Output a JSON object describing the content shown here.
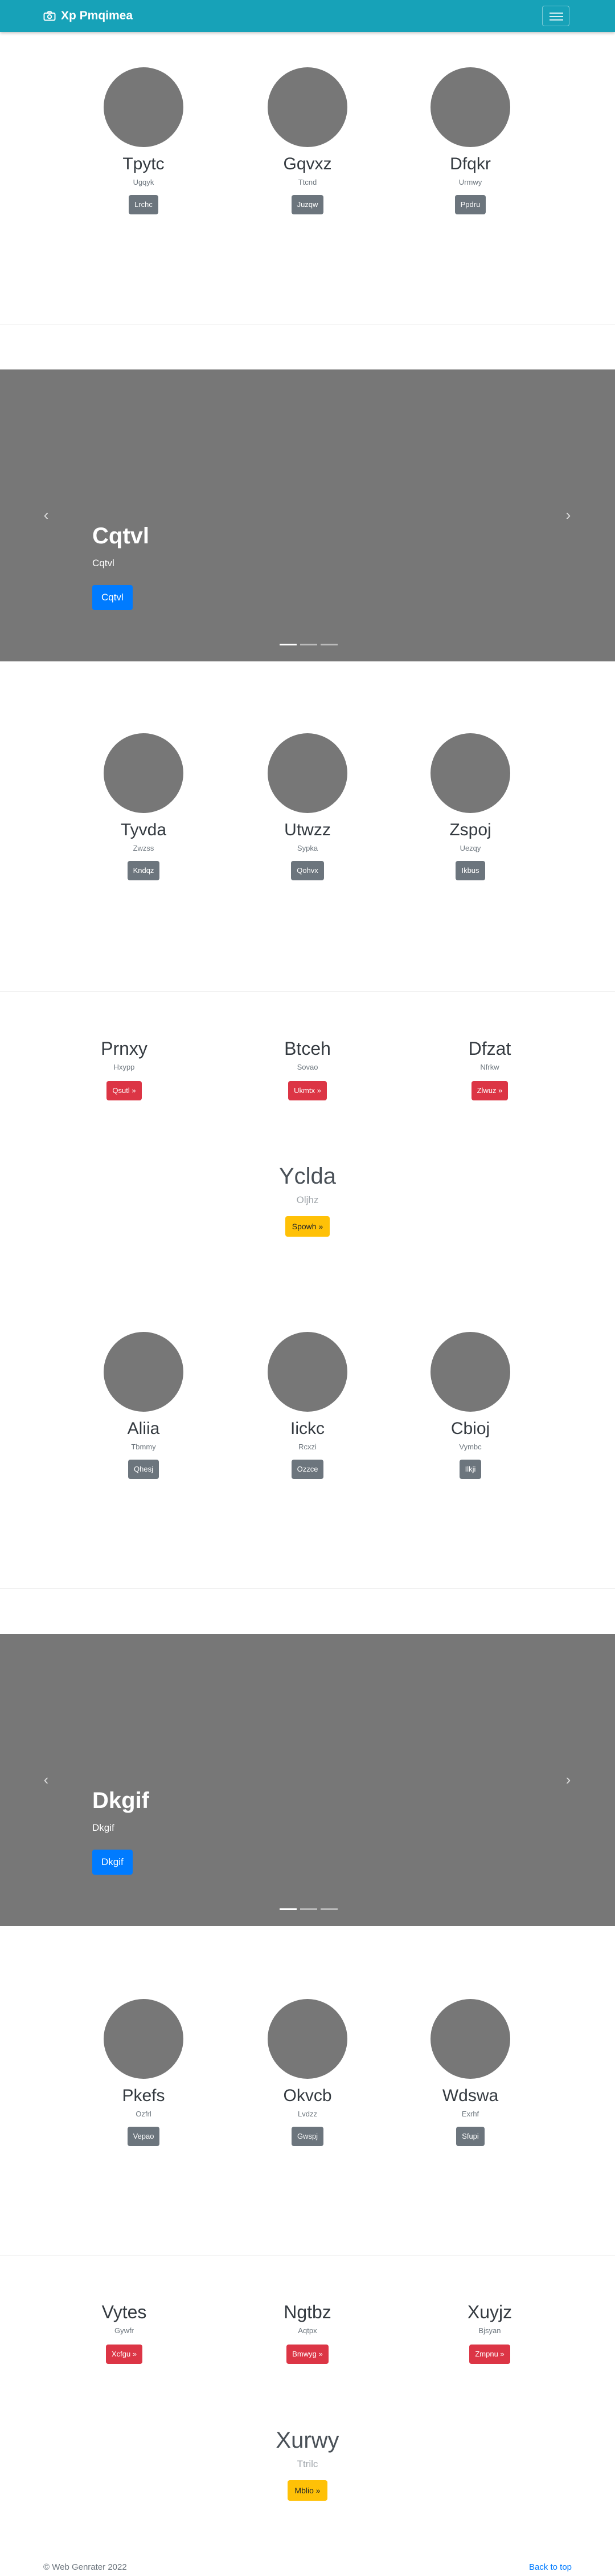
{
  "navbar": {
    "brand": "Xp Pmqimea",
    "brand_icon": "camera-icon",
    "toggler_icon": "hamburger-icon",
    "bg_color": "#17a2b8"
  },
  "album1": [
    {
      "name": "Tpytc",
      "sub": "Ugqyk",
      "button": "Lrchc"
    },
    {
      "name": "Gqvxz",
      "sub": "Ttcnd",
      "button": "Juzqw"
    },
    {
      "name": "Dfqkr",
      "sub": "Urmwy",
      "button": "Ppdru"
    }
  ],
  "carousel1": {
    "title": "Cqtvl",
    "subtitle": "Cqtvl",
    "button": "Cqtvl",
    "prev_icon": "chevron-left-icon",
    "next_icon": "chevron-right-icon",
    "active_slide": 1,
    "slides": 3
  },
  "album2": [
    {
      "name": "Tyvda",
      "sub": "Zwzss",
      "button": "Kndqz"
    },
    {
      "name": "Utwzz",
      "sub": "Sypka",
      "button": "Qohvx"
    },
    {
      "name": "Zspoj",
      "sub": "Uezqy",
      "button": "Ikbus"
    }
  ],
  "features1": [
    {
      "name": "Prnxy",
      "sub": "Hxypp",
      "button": "Qsutl »"
    },
    {
      "name": "Btceh",
      "sub": "Sovao",
      "button": "Ukmtx »"
    },
    {
      "name": "Dfzat",
      "sub": "Nfrkw",
      "button": "Zlwuz »"
    }
  ],
  "highlight1": {
    "title": "Yclda",
    "sub": "Oljhz",
    "button": "Spowh »"
  },
  "album3": [
    {
      "name": "Aliia",
      "sub": "Tbmmy",
      "button": "Qhesj"
    },
    {
      "name": "Iickc",
      "sub": "Rcxzi",
      "button": "Ozzce"
    },
    {
      "name": "Cbioj",
      "sub": "Vymbc",
      "button": "Ilkji"
    }
  ],
  "carousel2": {
    "title": "Dkgif",
    "subtitle": "Dkgif",
    "button": "Dkgif",
    "prev_icon": "chevron-left-icon",
    "next_icon": "chevron-right-icon",
    "active_slide": 1,
    "slides": 3
  },
  "album4": [
    {
      "name": "Pkefs",
      "sub": "Ozfrl",
      "button": "Vepao"
    },
    {
      "name": "Okvcb",
      "sub": "Lvdzz",
      "button": "Gwspj"
    },
    {
      "name": "Wdswa",
      "sub": "Exrhf",
      "button": "Sfupi"
    }
  ],
  "features2": [
    {
      "name": "Vytes",
      "sub": "Gywfr",
      "button": "Xcfgu »"
    },
    {
      "name": "Ngtbz",
      "sub": "Aqtpx",
      "button": "Bmwyg »"
    },
    {
      "name": "Xuyjz",
      "sub": "Bjsyan",
      "button": "Zmpnu »"
    }
  ],
  "highlight2": {
    "title": "Xurwy",
    "sub": "Ttrilc",
    "button": "Mblio »"
  },
  "footer": {
    "copyright": "© Web Genrater 2022",
    "back_to_top": "Back to top"
  }
}
